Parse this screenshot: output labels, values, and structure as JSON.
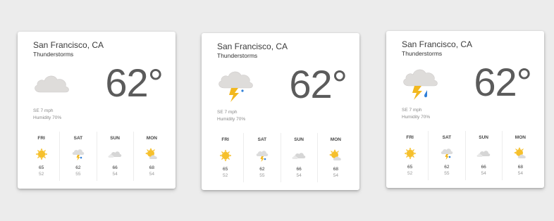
{
  "cards": [
    {
      "city": "San Francisco, CA",
      "condition": "Thunderstorms",
      "big_icon": "cloud-icon",
      "temperature": "62°",
      "wind": "SE 7 mph",
      "humidity": "Humidity 70%",
      "forecast": [
        {
          "day": "FRI",
          "icon": "sun-icon",
          "high": "65",
          "low": "52"
        },
        {
          "day": "SAT",
          "icon": "thunderstorm-icon",
          "high": "62",
          "low": "55"
        },
        {
          "day": "SUN",
          "icon": "cloudy-icon",
          "high": "66",
          "low": "54"
        },
        {
          "day": "MON",
          "icon": "partly-cloudy-icon",
          "high": "68",
          "low": "54"
        }
      ]
    },
    {
      "city": "San Francisco, CA",
      "condition": "Thunderstorms",
      "big_icon": "thunderstorm-icon",
      "temperature": "62°",
      "wind": "SE 7 mph",
      "humidity": "Humidity 70%",
      "forecast": [
        {
          "day": "FRI",
          "icon": "sun-icon",
          "high": "65",
          "low": "52"
        },
        {
          "day": "SAT",
          "icon": "thunderstorm-icon",
          "high": "62",
          "low": "55"
        },
        {
          "day": "SUN",
          "icon": "cloudy-icon",
          "high": "66",
          "low": "54"
        },
        {
          "day": "MON",
          "icon": "partly-cloudy-icon",
          "high": "68",
          "low": "54"
        }
      ]
    },
    {
      "city": "San Francisco, CA",
      "condition": "Thunderstorms",
      "big_icon": "thunderstorm-rain-icon",
      "temperature": "62°",
      "wind": "SE 7 mph",
      "humidity": "Humidity 70%",
      "forecast": [
        {
          "day": "FRI",
          "icon": "sun-icon",
          "high": "65",
          "low": "52"
        },
        {
          "day": "SAT",
          "icon": "thunderstorm-icon",
          "high": "62",
          "low": "55"
        },
        {
          "day": "SUN",
          "icon": "cloudy-icon",
          "high": "66",
          "low": "54"
        },
        {
          "day": "MON",
          "icon": "partly-cloudy-icon",
          "high": "68",
          "low": "54"
        }
      ]
    }
  ],
  "colors": {
    "background": "#ececec",
    "card": "#ffffff",
    "sun": "#f6c02c",
    "bolt": "#f2b81f",
    "rain": "#2f7fd8",
    "cloud": "#dcdcdc"
  }
}
